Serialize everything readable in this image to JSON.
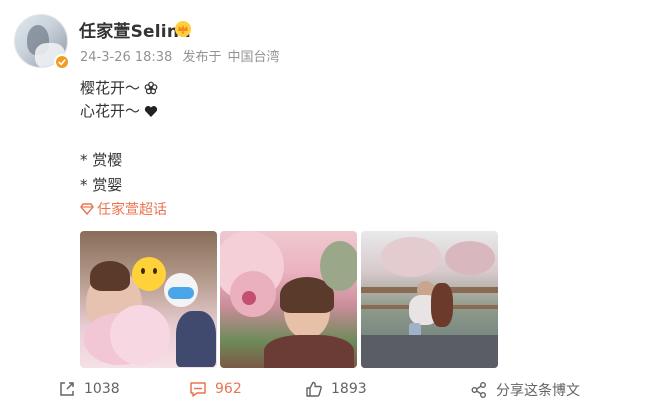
{
  "post": {
    "author": "任家萱Selina",
    "timestamp": "24-3-26 18:38",
    "source_prefix": "发布于",
    "location": "中国台湾",
    "lines": [
      "樱花开～",
      "心花开～",
      "* 赏樱",
      "* 赏婴"
    ],
    "topic_tag": "任家萱超话"
  },
  "actions": {
    "repost_count": "1038",
    "comment_count": "962",
    "like_count": "1893",
    "share_label": "分享这条博文"
  },
  "colors": {
    "accent": "#eb7350",
    "badge": "#f29c1f",
    "meta_text": "#939393"
  },
  "icons": [
    "crown-icon",
    "flower-icon",
    "heart-icon",
    "diamond-topic-icon",
    "repost-icon",
    "comment-icon",
    "like-icon",
    "share-icon",
    "verified-badge-icon"
  ]
}
